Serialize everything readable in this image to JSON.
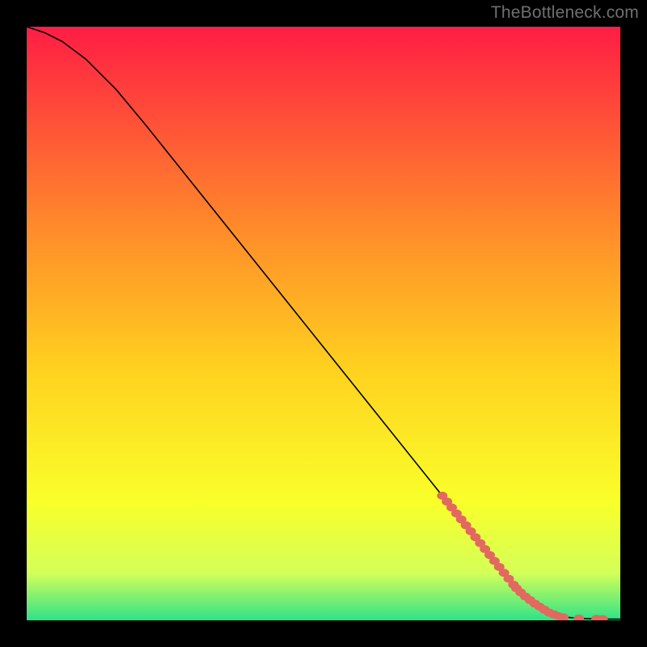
{
  "watermark": "TheBottleneck.com",
  "chart_data": {
    "type": "line",
    "title": "",
    "xlabel": "",
    "ylabel": "",
    "xlim": [
      0,
      100
    ],
    "ylim": [
      0,
      100
    ],
    "grid": false,
    "legend": false,
    "background_gradient": {
      "top": "#ff1d44",
      "mid_upper": "#ff8b2a",
      "mid": "#ffd21f",
      "mid_lower": "#f9ff2a",
      "lower": "#d4ff58",
      "bottom": "#2fe28a"
    },
    "series": [
      {
        "name": "curve",
        "type": "line",
        "color": "#000000",
        "x": [
          0,
          3,
          6,
          10,
          15,
          20,
          30,
          40,
          50,
          60,
          70,
          78,
          82,
          85,
          88,
          91,
          94,
          97,
          100
        ],
        "y": [
          100,
          99,
          97.5,
          94.5,
          89.5,
          83.5,
          71,
          58.5,
          46,
          33.5,
          21,
          11,
          6,
          3,
          1.3,
          0.5,
          0.3,
          0.2,
          0.2
        ]
      },
      {
        "name": "highlight-slope",
        "type": "scatter",
        "color": "#e2695f",
        "marker": "pill",
        "x": [
          70,
          70.8,
          71.6,
          72.4,
          73.2,
          74,
          74.8,
          75.6,
          76.4,
          77.2,
          78,
          78.8,
          79.6,
          80.4,
          81.2,
          82
        ],
        "y": [
          21,
          20,
          19,
          18,
          17,
          16,
          15,
          14,
          13,
          12,
          11,
          10,
          9,
          8,
          7,
          6
        ]
      },
      {
        "name": "highlight-tail",
        "type": "scatter",
        "color": "#e2695f",
        "marker": "pill",
        "x": [
          82.5,
          83.2,
          84,
          84.8,
          85.6,
          86.4,
          87.2,
          88,
          88.8,
          89.6,
          90.4,
          93,
          96,
          97
        ],
        "y": [
          5.4,
          4.7,
          4,
          3.4,
          2.8,
          2.3,
          1.8,
          1.3,
          1.0,
          0.7,
          0.5,
          0.3,
          0.25,
          0.2
        ]
      }
    ]
  }
}
